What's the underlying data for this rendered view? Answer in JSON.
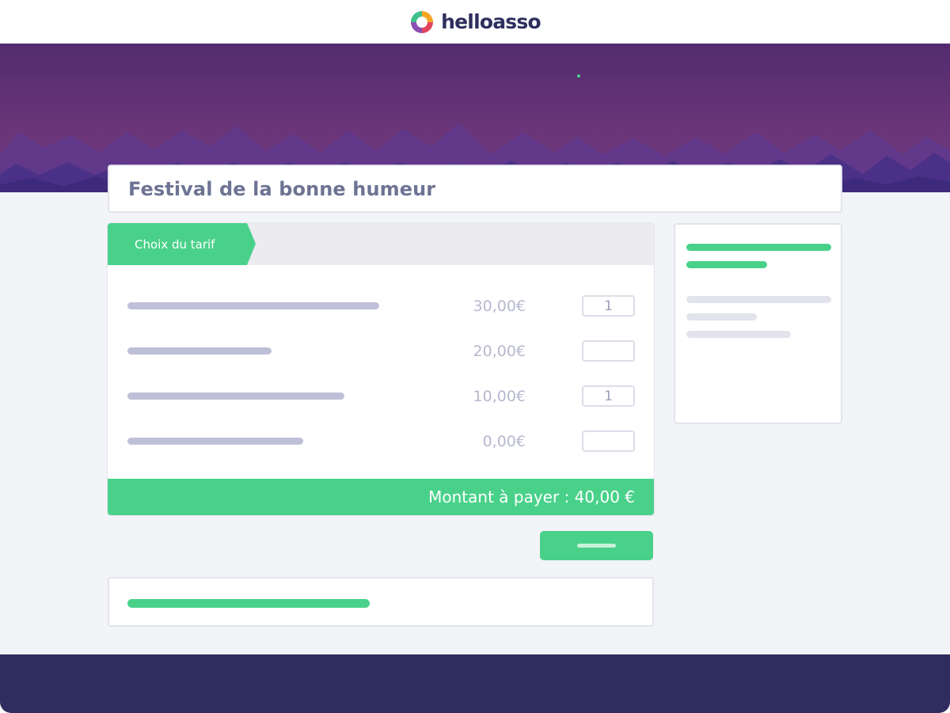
{
  "header": {
    "brand_name": "helloasso",
    "logo_icon": "helloasso-logo-icon"
  },
  "hero": {
    "sky_color_top": "#522c6f",
    "sky_color_bottom": "#6d3a7c",
    "mountain_color": "#4a3187"
  },
  "page": {
    "title": "Festival de la bonne humeur"
  },
  "tarif": {
    "tab_label": "Choix du tarif",
    "rows": [
      {
        "price": "30,00€",
        "quantity": "1"
      },
      {
        "price": "20,00€",
        "quantity": ""
      },
      {
        "price": "10,00€",
        "quantity": "1"
      },
      {
        "price": "0,00€",
        "quantity": ""
      }
    ],
    "total_label": "Montant à payer : 40,00 €"
  },
  "colors": {
    "accent_green": "#49d18a",
    "footer_navy": "#2e2d5d",
    "content_bg": "#f3f4f8",
    "placeholder_gray": "#bfc0d8"
  }
}
